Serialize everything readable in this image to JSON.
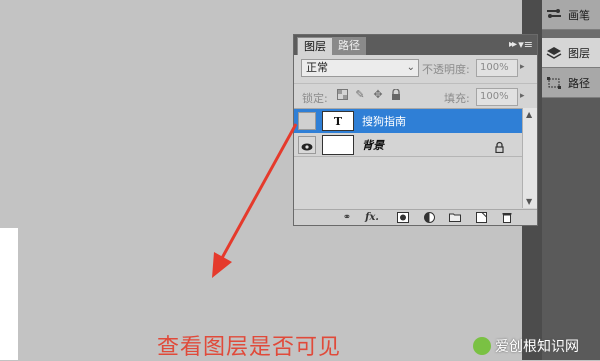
{
  "dock": {
    "brush_label": "画笔",
    "layers_label": "图层",
    "paths_label": "路径"
  },
  "panel": {
    "tabs": [
      {
        "label": "图层",
        "active": true
      },
      {
        "label": "路径",
        "active": false
      }
    ],
    "collapse_icon": "double-chevron-right-icon",
    "menu_icon": "panel-menu-icon",
    "blend_mode": "正常",
    "opacity_label": "不透明度:",
    "opacity_value": "100%",
    "lock_label": "锁定:",
    "fill_label": "填充:",
    "fill_value": "100%",
    "layers": [
      {
        "name": "搜狗指南",
        "thumb": "T",
        "type": "text",
        "visible": false,
        "selected": true
      },
      {
        "name": "背景",
        "thumb": "",
        "type": "background",
        "visible": true,
        "locked": true,
        "selected": false
      }
    ],
    "bottom_icons": [
      "link-icon",
      "fx-icon",
      "mask-icon",
      "adjustment-icon",
      "group-icon",
      "new-layer-icon",
      "trash-icon"
    ]
  },
  "annotation": {
    "caption": "查看图层是否可见",
    "arrow_color": "#e53a2c"
  },
  "watermark": {
    "text": "爱创根知识网"
  },
  "colors": {
    "selection": "#2f7fd6",
    "caption": "#e04a3a"
  }
}
